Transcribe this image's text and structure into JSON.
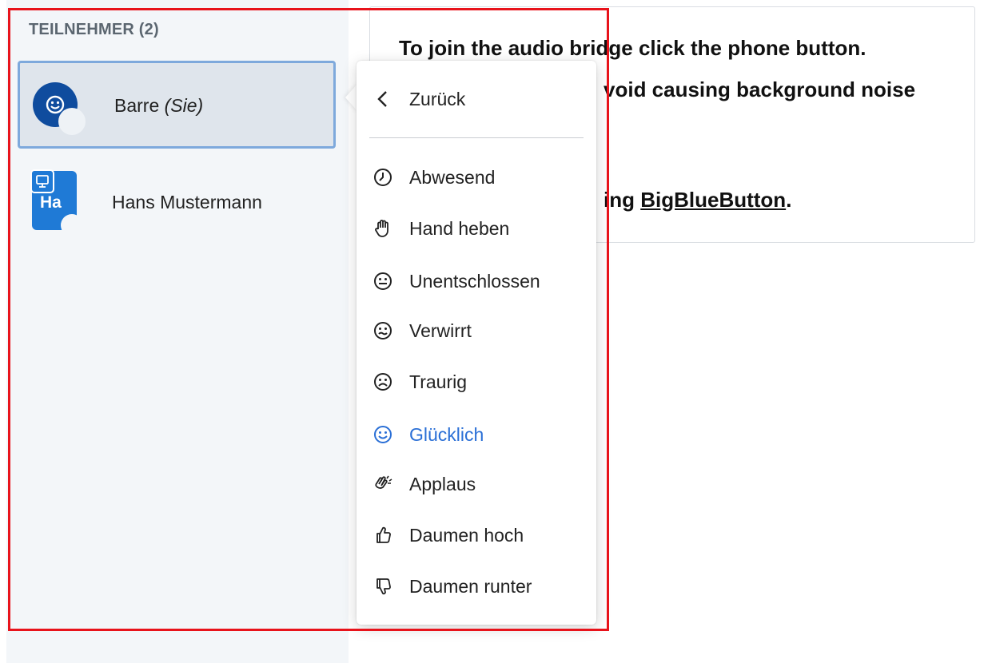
{
  "sidebar": {
    "title": "TEILNEHMER (2)",
    "users": [
      {
        "name": "Barre",
        "suffix": "(Sie)",
        "status_icon": "happy-face-icon",
        "avatar_color": "#0f4c9e"
      },
      {
        "name": "Hans Mustermann",
        "initials": "Ha",
        "avatar_color": "#1f7ad6",
        "badge_icon": "presenter-icon"
      }
    ]
  },
  "content": {
    "line1": "To join the audio bridge click the phone button.",
    "line2": "void causing background noise",
    "line3_prefix": "ing ",
    "line3_link": "BigBlueButton",
    "line3_suffix": "."
  },
  "status_menu": {
    "back_label": "Zurück",
    "items": [
      {
        "label": "Abwesend",
        "icon": "clock-icon"
      },
      {
        "label": "Hand heben",
        "icon": "raised-hand-icon"
      },
      {
        "label": "Unentschlossen",
        "icon": "neutral-face-icon"
      },
      {
        "label": "Verwirrt",
        "icon": "confused-face-icon"
      },
      {
        "label": "Traurig",
        "icon": "sad-face-icon"
      },
      {
        "label": "Glücklich",
        "icon": "happy-face-icon",
        "selected": true
      },
      {
        "label": "Applaus",
        "icon": "applause-icon"
      },
      {
        "label": "Daumen hoch",
        "icon": "thumbs-up-icon"
      },
      {
        "label": "Daumen runter",
        "icon": "thumbs-down-icon"
      }
    ],
    "selected_color": "#2a6fd6"
  },
  "highlight_color": "#e8131b"
}
